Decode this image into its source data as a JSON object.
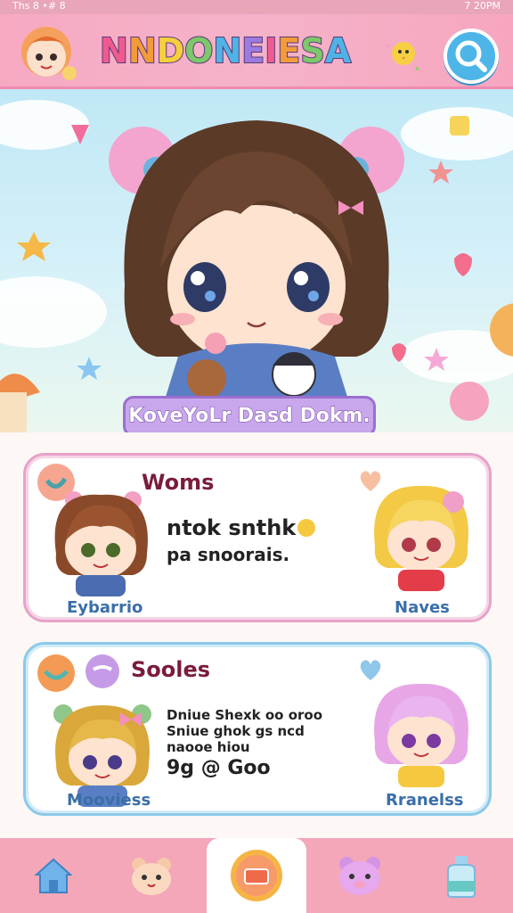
{
  "status_bar": {
    "left": "Ths 8 •# 8",
    "right": "7 20PM"
  },
  "header": {
    "title": "NNDONEIESA",
    "title_colors": [
      "#f05a8f",
      "#f29b3a",
      "#f6cf3c",
      "#7cc86b",
      "#4fb3e6",
      "#9b7be0",
      "#f05a8f",
      "#f29b3a",
      "#7cc86b",
      "#4fb3e6"
    ],
    "search_icon": "search-icon"
  },
  "hero": {
    "caption": "KoveYoLr Dasd Dokm."
  },
  "card1": {
    "title": "Woms",
    "text_line1": "ntok snthk",
    "text_line2": "pa snoorais.",
    "left_name": "Eybarrio",
    "right_name": "Naves"
  },
  "card2": {
    "title": "Sooles",
    "text_line1": "Dniue Shexk oo oroo",
    "text_line2": "Sniue ghok gs ncd",
    "text_line3": "naooe hiou",
    "text_line4": "9g @ Goo",
    "left_name": "Mooviess",
    "right_name": "Rranelss"
  },
  "nav": {
    "items": [
      "home",
      "bear",
      "card",
      "pig",
      "bottle"
    ]
  },
  "colors": {
    "header": "#f4b3c9",
    "accent_pink": "#f08bb0",
    "accent_blue": "#4db5e8",
    "caption_purple": "#c9a7ec"
  }
}
